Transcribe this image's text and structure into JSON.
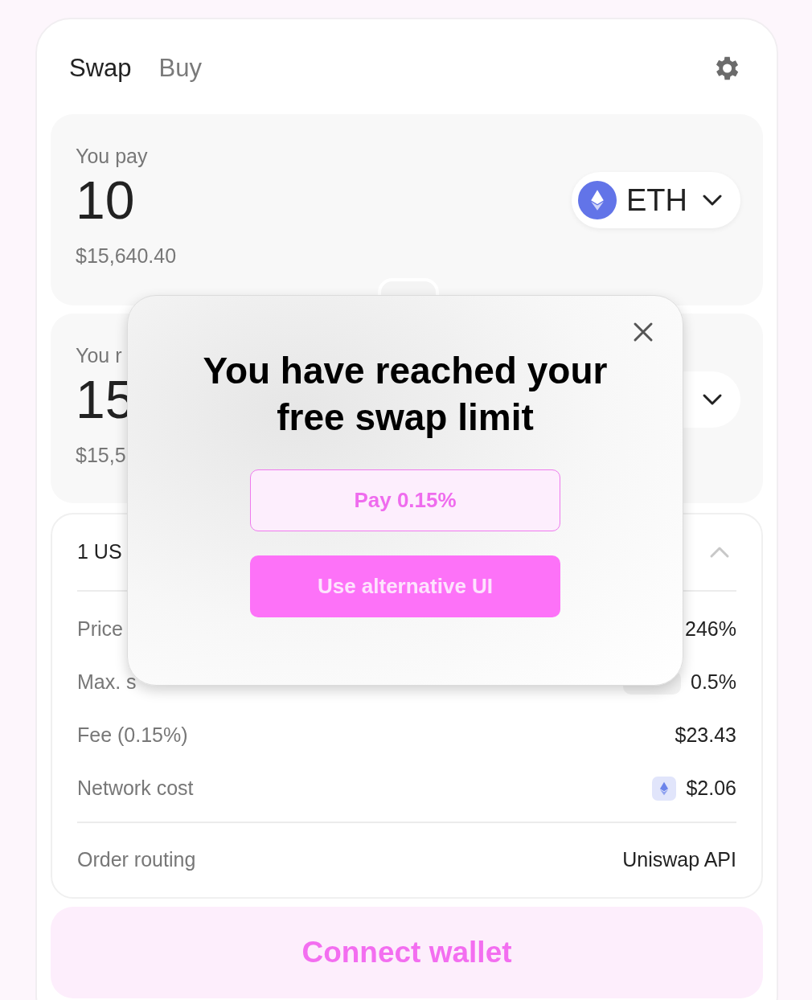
{
  "tabs": [
    {
      "label": "Swap",
      "selected": true
    },
    {
      "label": "Buy",
      "selected": false
    }
  ],
  "pay": {
    "label": "You pay",
    "amount": "10",
    "usd": "$15,640.40",
    "token": "ETH"
  },
  "receive": {
    "label": "You r",
    "amount": "15",
    "usd": "$15,5"
  },
  "details": {
    "rate": "1 US",
    "expanded": true,
    "rows": [
      {
        "kind": "plain",
        "label": "Price",
        "value": "246%"
      },
      {
        "kind": "slippage",
        "label": "Max. s",
        "value": "0.5%"
      },
      {
        "kind": "plain",
        "label": "Fee (0.15%)",
        "value": "$23.43"
      },
      {
        "kind": "network",
        "label": "Network cost",
        "value": "$2.06"
      }
    ],
    "routing": {
      "label": "Order routing",
      "value": "Uniswap API"
    }
  },
  "connect_button": "Connect wallet",
  "modal": {
    "title": "You have reached your free swap limit",
    "buttons": [
      {
        "kind": "secondary",
        "label": "Pay 0.15%"
      },
      {
        "kind": "primary",
        "label": "Use alternative UI"
      }
    ]
  }
}
